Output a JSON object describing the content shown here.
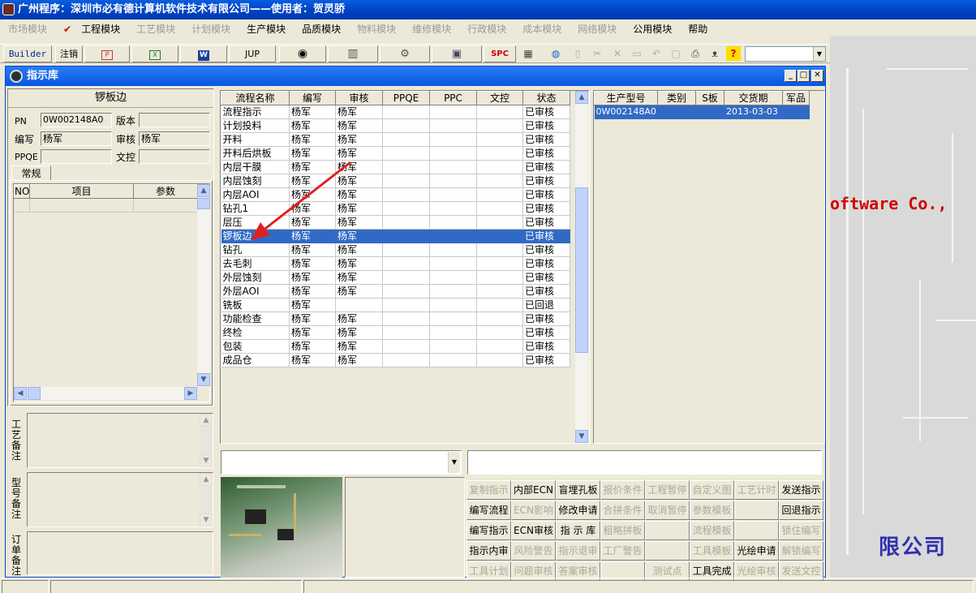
{
  "app_title": "广州程序：深圳市必有德计算机软件技术有限公司——使用者：贺灵骄",
  "menu": [
    {
      "label": "市场模块",
      "enabled": false
    },
    {
      "label": "工程模块",
      "enabled": true,
      "checked": true
    },
    {
      "label": "工艺模块",
      "enabled": false
    },
    {
      "label": "计划模块",
      "enabled": false
    },
    {
      "label": "生产模块",
      "enabled": true
    },
    {
      "label": "品质模块",
      "enabled": true
    },
    {
      "label": "物料模块",
      "enabled": false
    },
    {
      "label": "维修模块",
      "enabled": false
    },
    {
      "label": "行政模块",
      "enabled": false
    },
    {
      "label": "成本模块",
      "enabled": false
    },
    {
      "label": "网络模块",
      "enabled": false
    },
    {
      "label": "公用模块",
      "enabled": true
    },
    {
      "label": "帮助",
      "enabled": true
    }
  ],
  "toolbar": {
    "builder": "Builder",
    "logout": "注销",
    "jup": "JUP",
    "spc": "SPC"
  },
  "background": {
    "text": "oftware Co.,",
    "logo_text": "限公司"
  },
  "window": {
    "title": "指示库"
  },
  "left": {
    "heading": "锣板边",
    "pn_label": "PN",
    "pn_value": "0W002148A0",
    "version_label": "版本",
    "version_value": "",
    "editor_label": "编写",
    "editor_value": "杨军",
    "reviewer_label": "审核",
    "reviewer_value": "杨军",
    "ppqe_label": "PPQE",
    "ppqe_value": "",
    "doc_label": "文控",
    "doc_value": "",
    "tab": "常规",
    "param_headers": [
      "NO",
      "项目",
      "参数"
    ],
    "remarks": [
      "工艺备注",
      "型号备注",
      "订单备注"
    ]
  },
  "process": {
    "headers": [
      "流程名称",
      "编写",
      "审核",
      "PPQE",
      "PPC",
      "文控",
      "状态"
    ],
    "selected_index": 9,
    "rows": [
      [
        "流程指示",
        "杨军",
        "杨军",
        "",
        "",
        "",
        "已审核"
      ],
      [
        "计划投料",
        "杨军",
        "杨军",
        "",
        "",
        "",
        "已审核"
      ],
      [
        "开料",
        "杨军",
        "杨军",
        "",
        "",
        "",
        "已审核"
      ],
      [
        "开料后烘板",
        "杨军",
        "杨军",
        "",
        "",
        "",
        "已审核"
      ],
      [
        "内层干膜",
        "杨军",
        "杨军",
        "",
        "",
        "",
        "已审核"
      ],
      [
        "内层蚀刻",
        "杨军",
        "杨军",
        "",
        "",
        "",
        "已审核"
      ],
      [
        "内层AOI",
        "杨军",
        "杨军",
        "",
        "",
        "",
        "已审核"
      ],
      [
        "钻孔1",
        "杨军",
        "杨军",
        "",
        "",
        "",
        "已审核"
      ],
      [
        "层压",
        "杨军",
        "杨军",
        "",
        "",
        "",
        "已审核"
      ],
      [
        "锣板边",
        "杨军",
        "杨军",
        "",
        "",
        "",
        "已审核"
      ],
      [
        "钻孔",
        "杨军",
        "杨军",
        "",
        "",
        "",
        "已审核"
      ],
      [
        "去毛刺",
        "杨军",
        "杨军",
        "",
        "",
        "",
        "已审核"
      ],
      [
        "外层蚀刻",
        "杨军",
        "杨军",
        "",
        "",
        "",
        "已审核"
      ],
      [
        "外层AOI",
        "杨军",
        "杨军",
        "",
        "",
        "",
        "已审核"
      ],
      [
        "铣板",
        "杨军",
        "",
        "",
        "",
        "",
        "已回退"
      ],
      [
        "功能检查",
        "杨军",
        "杨军",
        "",
        "",
        "",
        "已审核"
      ],
      [
        "终检",
        "杨军",
        "杨军",
        "",
        "",
        "",
        "已审核"
      ],
      [
        "包装",
        "杨军",
        "杨军",
        "",
        "",
        "",
        "已审核"
      ],
      [
        "成品仓",
        "杨军",
        "杨军",
        "",
        "",
        "",
        "已审核"
      ]
    ]
  },
  "production": {
    "headers": [
      "生产型号",
      "类别",
      "S板",
      "交货期",
      "军品"
    ],
    "rows": [
      [
        "0W002148A0",
        "",
        "",
        "2013-03-03",
        ""
      ]
    ]
  },
  "buttons": [
    [
      {
        "label": "复制指示",
        "enabled": false
      },
      {
        "label": "内部ECN",
        "enabled": true
      },
      {
        "label": "盲埋孔板",
        "enabled": true
      },
      {
        "label": "报价条件",
        "enabled": false
      },
      {
        "label": "工程暂停",
        "enabled": false
      },
      {
        "label": "自定义图",
        "enabled": false
      },
      {
        "label": "工艺计时",
        "enabled": false
      },
      {
        "label": "发送指示",
        "enabled": true
      }
    ],
    [
      {
        "label": "编写流程",
        "enabled": true
      },
      {
        "label": "ECN影响",
        "enabled": false
      },
      {
        "label": "修改申请",
        "enabled": true
      },
      {
        "label": "合拼条件",
        "enabled": false
      },
      {
        "label": "取消暂停",
        "enabled": false
      },
      {
        "label": "参数模板",
        "enabled": false
      },
      {
        "label": "",
        "enabled": false
      },
      {
        "label": "回退指示",
        "enabled": true
      }
    ],
    [
      {
        "label": "编写指示",
        "enabled": true
      },
      {
        "label": "ECN审核",
        "enabled": true
      },
      {
        "label": "指 示 库",
        "enabled": true
      },
      {
        "label": "粗略拼板",
        "enabled": false
      },
      {
        "label": "",
        "enabled": false
      },
      {
        "label": "流程模板",
        "enabled": false
      },
      {
        "label": "",
        "enabled": false
      },
      {
        "label": "锁住编写",
        "enabled": false
      }
    ],
    [
      {
        "label": "指示内审",
        "enabled": true
      },
      {
        "label": "风险警告",
        "enabled": false
      },
      {
        "label": "指示退审",
        "enabled": false
      },
      {
        "label": "工厂警告",
        "enabled": false
      },
      {
        "label": "",
        "enabled": false
      },
      {
        "label": "工具模板",
        "enabled": false
      },
      {
        "label": "光绘申请",
        "enabled": true
      },
      {
        "label": "解锁编写",
        "enabled": false
      }
    ],
    [
      {
        "label": "工具计划",
        "enabled": false
      },
      {
        "label": "问题审核",
        "enabled": false
      },
      {
        "label": "答案审核",
        "enabled": false
      },
      {
        "label": "",
        "enabled": false
      },
      {
        "label": "测试点",
        "enabled": false
      },
      {
        "label": "工具完成",
        "enabled": true
      },
      {
        "label": "光绘审核",
        "enabled": false
      },
      {
        "label": "发送文控",
        "enabled": false
      }
    ]
  ],
  "colors": {
    "selection": "#316ac5",
    "titlebar": "#0a5ee0",
    "arrow": "#e02020"
  }
}
